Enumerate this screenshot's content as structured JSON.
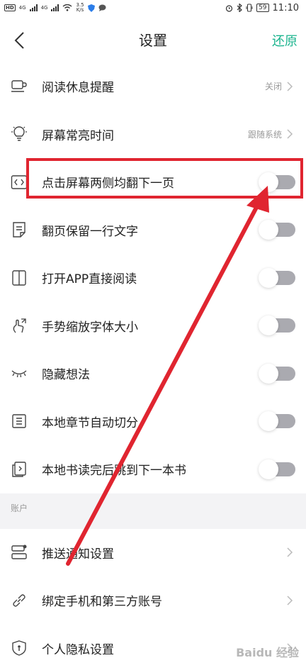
{
  "status_bar": {
    "left_badge": "HD",
    "network_4g_a": "4G",
    "network_4g_b": "4G",
    "net_speed": "3.5",
    "net_speed_unit": "K/s",
    "battery": "59",
    "time": "11:10"
  },
  "header": {
    "title": "设置",
    "restore_label": "还原"
  },
  "settings": [
    {
      "label": "阅读休息提醒",
      "value": "关闭",
      "control": "chevron",
      "icon": "cup-icon"
    },
    {
      "label": "屏幕常亮时间",
      "value": "跟随系统",
      "control": "chevron",
      "icon": "bulb-icon"
    },
    {
      "label": "点击屏幕两侧均翻下一页",
      "control": "toggle",
      "on": false,
      "icon": "code-icon"
    },
    {
      "label": "翻页保留一行文字",
      "control": "toggle",
      "on": false,
      "icon": "note-icon"
    },
    {
      "label": "打开APP直接阅读",
      "control": "toggle",
      "on": false,
      "icon": "book-icon"
    },
    {
      "label": "手势缩放字体大小",
      "control": "toggle",
      "on": false,
      "icon": "gesture-icon"
    },
    {
      "label": "隐藏想法",
      "control": "toggle",
      "on": false,
      "icon": "eye-closed-icon"
    },
    {
      "label": "本地章节自动切分",
      "control": "toggle",
      "on": false,
      "icon": "list-icon"
    },
    {
      "label": "本地书读完后跳到下一本书",
      "control": "toggle",
      "on": false,
      "icon": "next-book-icon"
    }
  ],
  "account_section": {
    "title": "账户",
    "items": [
      {
        "label": "推送通知设置",
        "icon": "push-icon"
      },
      {
        "label": "绑定手机和第三方账号",
        "icon": "link-icon"
      },
      {
        "label": "个人隐私设置",
        "icon": "shield-icon"
      }
    ]
  },
  "watermark": "Baidu 经验",
  "colors": {
    "accent": "#1bb48e",
    "annotation": "#e02530",
    "toggle_off": "#aaaab0"
  }
}
